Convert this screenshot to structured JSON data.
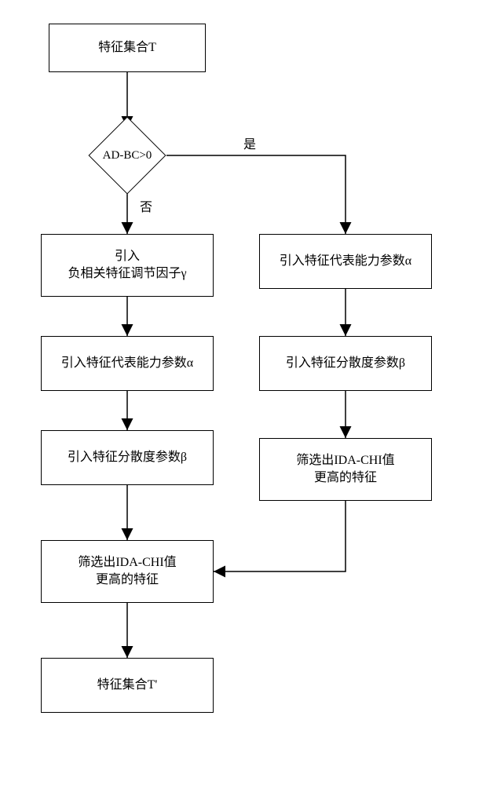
{
  "chart_data": {
    "type": "flowchart",
    "nodes": [
      {
        "id": "start",
        "kind": "process",
        "label": "特征集合T"
      },
      {
        "id": "dec",
        "kind": "decision",
        "label": "AD-BC>0"
      },
      {
        "id": "l1",
        "kind": "process",
        "label": "引入\n负相关特征调节因子γ"
      },
      {
        "id": "l2",
        "kind": "process",
        "label": "引入特征代表能力参数α"
      },
      {
        "id": "l3",
        "kind": "process",
        "label": "引入特征分散度参数β"
      },
      {
        "id": "l4",
        "kind": "process",
        "label": "筛选出IDA-CHI值\n更高的特征"
      },
      {
        "id": "end",
        "kind": "process",
        "label": "特征集合T'"
      },
      {
        "id": "r1",
        "kind": "process",
        "label": "引入特征代表能力参数α"
      },
      {
        "id": "r2",
        "kind": "process",
        "label": "引入特征分散度参数β"
      },
      {
        "id": "r3",
        "kind": "process",
        "label": "筛选出IDA-CHI值\n更高的特征"
      }
    ],
    "edges": [
      {
        "from": "start",
        "to": "dec"
      },
      {
        "from": "dec",
        "to": "l1",
        "label": "否"
      },
      {
        "from": "dec",
        "to": "r1",
        "label": "是"
      },
      {
        "from": "l1",
        "to": "l2"
      },
      {
        "from": "l2",
        "to": "l3"
      },
      {
        "from": "l3",
        "to": "l4"
      },
      {
        "from": "l4",
        "to": "end"
      },
      {
        "from": "r1",
        "to": "r2"
      },
      {
        "from": "r2",
        "to": "r3"
      },
      {
        "from": "r3",
        "to": "l4"
      }
    ],
    "edge_labels": {
      "yes": "是",
      "no": "否"
    }
  }
}
